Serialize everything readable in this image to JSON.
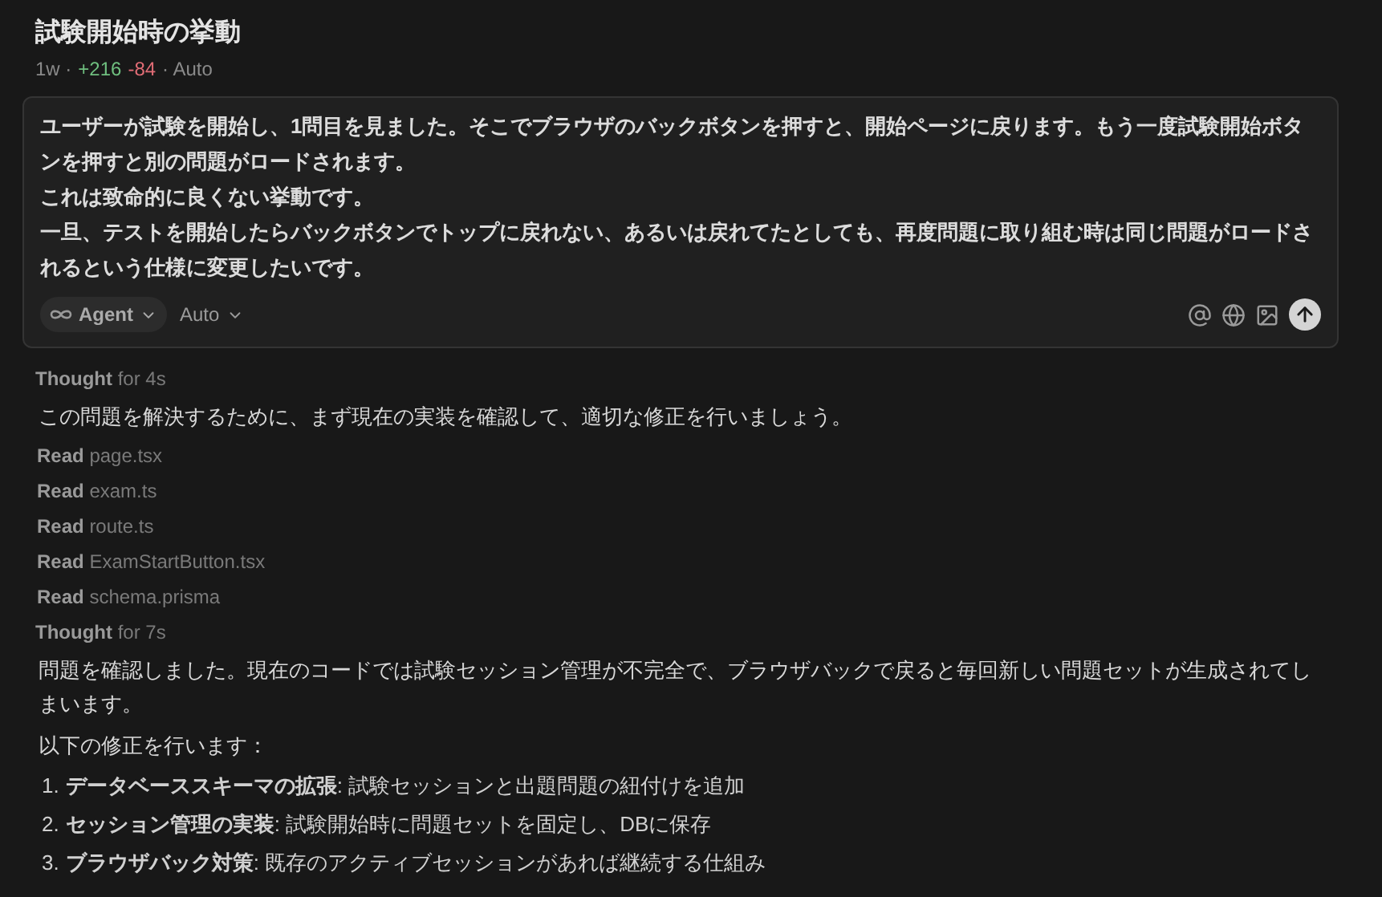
{
  "title": "試験開始時の挙動",
  "meta": {
    "age": "1w ·",
    "added": "+216",
    "removed": "-84",
    "mode": "· Auto"
  },
  "prompt": {
    "paragraphs": [
      "ユーザーが試験を開始し、1問目を見ました。そこでブラウザのバックボタンを押すと、開始ページに戻ります。もう一度試験開始ボタンを押すと別の問題がロードされます。",
      "これは致命的に良くない挙動です。",
      "一旦、テストを開始したらバックボタンでトップに戻れない、あるいは戻れてたとしても、再度問題に取り組む時は同じ問題がロードされるという仕様に変更したいです。"
    ],
    "agent_label": "Agent",
    "model_label": "Auto"
  },
  "steps": [
    {
      "kind": "thought",
      "label": "Thought",
      "detail": "for 4s"
    },
    {
      "kind": "text",
      "text": "この問題を解決するために、まず現在の実装を確認して、適切な修正を行いましょう。"
    },
    {
      "kind": "read",
      "label": "Read",
      "detail": "page.tsx"
    },
    {
      "kind": "read",
      "label": "Read",
      "detail": "exam.ts"
    },
    {
      "kind": "read",
      "label": "Read",
      "detail": "route.ts"
    },
    {
      "kind": "read",
      "label": "Read",
      "detail": "ExamStartButton.tsx"
    },
    {
      "kind": "read",
      "label": "Read",
      "detail": "schema.prisma"
    },
    {
      "kind": "thought",
      "label": "Thought",
      "detail": "for 7s"
    },
    {
      "kind": "text",
      "text": "問題を確認しました。現在のコードでは試験セッション管理が不完全で、ブラウザバックで戻ると毎回新しい問題セットが生成されてしまいます。"
    },
    {
      "kind": "text",
      "text": "以下の修正を行います："
    },
    {
      "kind": "item",
      "number": "1.",
      "text": "**データベーススキーマの拡張**: 試験セッションと出題問題の紐付けを追加"
    },
    {
      "kind": "item",
      "number": "2.",
      "text": "**セッション管理の実装**: 試験開始時に問題セットを固定し、DBに保存"
    },
    {
      "kind": "item",
      "number": "3.",
      "text": "**ブラウザバック対策**: 既存のアクティブセッションがあれば継続する仕組み"
    }
  ]
}
